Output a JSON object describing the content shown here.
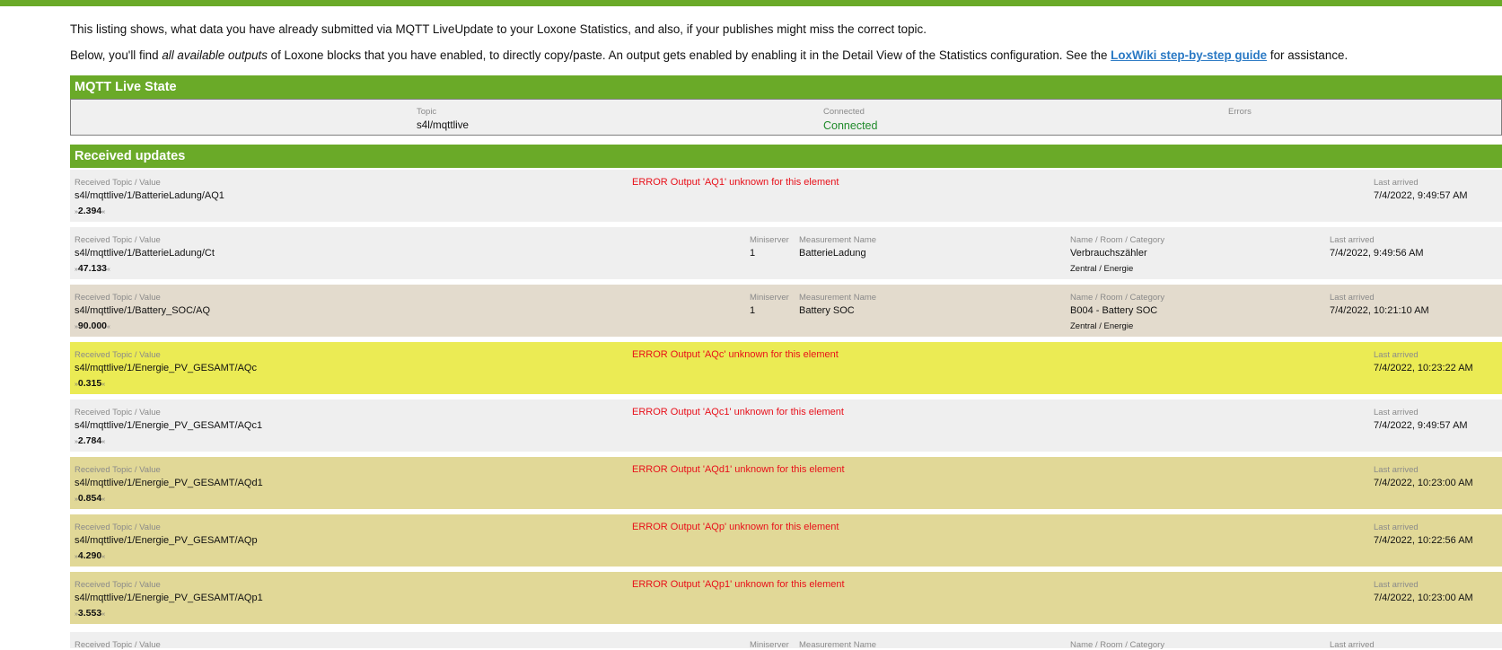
{
  "intro": {
    "line1": "This listing shows, what data you have already submitted via MQTT LiveUpdate to your Loxone Statistics, and also, if your publishes might miss the correct topic.",
    "line2_prefix": "Below, you'll find ",
    "line2_em": "all available outputs",
    "line2_mid": " of Loxone blocks that you have enabled, to directly copy/paste. An output gets enabled by enabling it in the Detail View of the Statistics configuration. See the ",
    "line2_link": "LoxWiki step-by-step guide",
    "line2_suffix": " for assistance."
  },
  "live_state": {
    "title": "MQTT Live State",
    "topic_label": "Topic",
    "topic_value": "s4l/mqttlive",
    "connected_label": "Connected",
    "connected_value": "Connected",
    "errors_label": "Errors"
  },
  "updates": {
    "title": "Received updates",
    "labels": {
      "topic": "Received Topic / Value",
      "miniserver": "Miniserver",
      "measurement": "Measurement Name",
      "name": "Name / Room / Category",
      "last": "Last arrived"
    },
    "quote_open": "»",
    "quote_close": "«",
    "rows": [
      {
        "topic": "s4l/mqttlive/1/BatterieLadung/AQ1",
        "value": "2.394",
        "error": "ERROR Output 'AQ1' unknown for this element",
        "last": "7/4/2022, 9:49:57 AM",
        "bg": "grey"
      },
      {
        "topic": "s4l/mqttlive/1/BatterieLadung/Ct",
        "value": "47.133",
        "miniserver": "1",
        "measurement": "BatterieLadung",
        "name": "Verbrauchszähler",
        "roomcat": "Zentral / Energie",
        "last": "7/4/2022, 9:49:56 AM",
        "bg": "grey"
      },
      {
        "topic": "s4l/mqttlive/1/Battery_SOC/AQ",
        "value": "90.000",
        "miniserver": "1",
        "measurement": "Battery SOC",
        "name": "B004 - Battery SOC",
        "roomcat": "Zentral / Energie",
        "last": "7/4/2022, 10:21:10 AM",
        "bg": "tan"
      },
      {
        "topic": "s4l/mqttlive/1/Energie_PV_GESAMT/AQc",
        "value": "0.315",
        "error": "ERROR Output 'AQc' unknown for this element",
        "last": "7/4/2022, 10:23:22 AM",
        "bg": "yellow"
      },
      {
        "topic": "s4l/mqttlive/1/Energie_PV_GESAMT/AQc1",
        "value": "2.784",
        "error": "ERROR Output 'AQc1' unknown for this element",
        "last": "7/4/2022, 9:49:57 AM",
        "bg": "grey"
      },
      {
        "topic": "s4l/mqttlive/1/Energie_PV_GESAMT/AQd1",
        "value": "0.854",
        "error": "ERROR Output 'AQd1' unknown for this element",
        "last": "7/4/2022, 10:23:00 AM",
        "bg": "olive"
      },
      {
        "topic": "s4l/mqttlive/1/Energie_PV_GESAMT/AQp",
        "value": "4.290",
        "error": "ERROR Output 'AQp' unknown for this element",
        "last": "7/4/2022, 10:22:56 AM",
        "bg": "olive"
      },
      {
        "topic": "s4l/mqttlive/1/Energie_PV_GESAMT/AQp1",
        "value": "3.553",
        "error": "ERROR Output 'AQp1' unknown for this element",
        "last": "7/4/2022, 10:23:00 AM",
        "bg": "olive"
      }
    ]
  }
}
